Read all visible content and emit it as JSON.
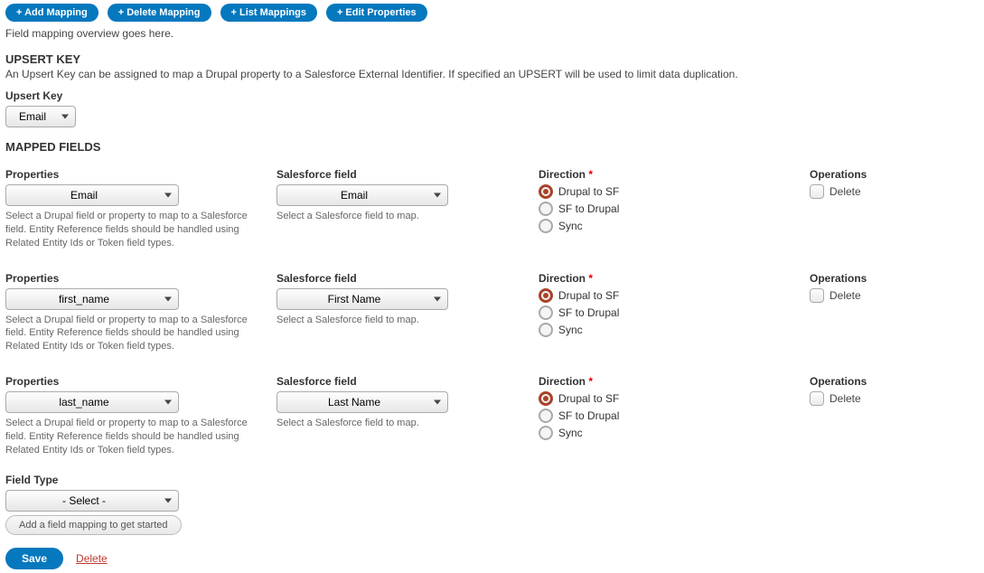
{
  "toolbar": {
    "add_mapping": "+ Add Mapping",
    "delete_mapping": "+ Delete Mapping",
    "list_mappings": "+ List Mappings",
    "edit_properties": "+ Edit Properties"
  },
  "overview": "Field mapping overview goes here.",
  "upsert": {
    "title": "UPSERT KEY",
    "desc": "An Upsert Key can be assigned to map a Drupal property to a Salesforce External Identifier. If specified an UPSERT will be used to limit data duplication.",
    "label": "Upsert Key",
    "value": "Email"
  },
  "mapped_title": "MAPPED FIELDS",
  "headers": {
    "properties": "Properties",
    "sf": "Salesforce field",
    "direction": "Direction",
    "operations": "Operations"
  },
  "help": {
    "properties": "Select a Drupal field or property to map to a Salesforce field. Entity Reference fields should be handled using Related Entity Ids or Token field types.",
    "sf": "Select a Salesforce field to map."
  },
  "dir_options": {
    "d2s": "Drupal to SF",
    "s2d": "SF to Drupal",
    "sync": "Sync"
  },
  "op_delete": "Delete",
  "rows": [
    {
      "property": "Email",
      "sf": "Email",
      "direction": "d2s"
    },
    {
      "property": "first_name",
      "sf": "First Name",
      "direction": "d2s"
    },
    {
      "property": "last_name",
      "sf": "Last Name",
      "direction": "d2s"
    }
  ],
  "field_type": {
    "label": "Field Type",
    "value": "- Select -"
  },
  "footer_add_hint": "Add a field mapping to get started",
  "actions": {
    "save": "Save",
    "delete": "Delete"
  }
}
